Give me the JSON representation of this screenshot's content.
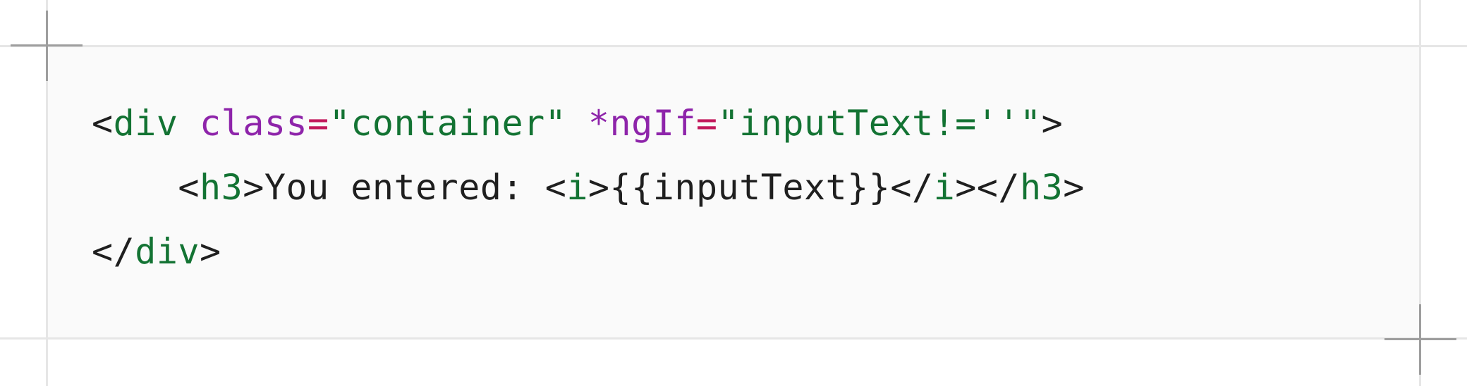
{
  "code_block": {
    "language": "html",
    "lines": [
      {
        "indent": "",
        "tokens": [
          {
            "type": "punct",
            "text": "<"
          },
          {
            "type": "tag",
            "text": "div"
          },
          {
            "type": "text",
            "text": " "
          },
          {
            "type": "attr",
            "text": "class"
          },
          {
            "type": "eq",
            "text": "="
          },
          {
            "type": "str",
            "text": "\"container\""
          },
          {
            "type": "text",
            "text": " "
          },
          {
            "type": "attr",
            "text": "*ngIf"
          },
          {
            "type": "eq",
            "text": "="
          },
          {
            "type": "str",
            "text": "\"inputText!=''\""
          },
          {
            "type": "punct",
            "text": ">"
          }
        ]
      },
      {
        "indent": "    ",
        "tokens": [
          {
            "type": "punct",
            "text": "<"
          },
          {
            "type": "tag",
            "text": "h3"
          },
          {
            "type": "punct",
            "text": ">"
          },
          {
            "type": "text",
            "text": "You entered: "
          },
          {
            "type": "punct",
            "text": "<"
          },
          {
            "type": "tag",
            "text": "i"
          },
          {
            "type": "punct",
            "text": ">"
          },
          {
            "type": "text",
            "text": "{{inputText}}"
          },
          {
            "type": "punct",
            "text": "</"
          },
          {
            "type": "tag",
            "text": "i"
          },
          {
            "type": "punct",
            "text": "></"
          },
          {
            "type": "tag",
            "text": "h3"
          },
          {
            "type": "punct",
            "text": ">"
          }
        ]
      },
      {
        "indent": "",
        "tokens": [
          {
            "type": "punct",
            "text": "</"
          },
          {
            "type": "tag",
            "text": "div"
          },
          {
            "type": "punct",
            "text": ">"
          }
        ]
      }
    ]
  },
  "colors": {
    "tag": "#137333",
    "attr": "#8e24aa",
    "eq": "#c2185b",
    "string": "#137333",
    "text": "#1f1f1f",
    "panel_bg": "#fafafa",
    "guide": "#e6e6e6",
    "crosshair": "#9e9e9e"
  }
}
